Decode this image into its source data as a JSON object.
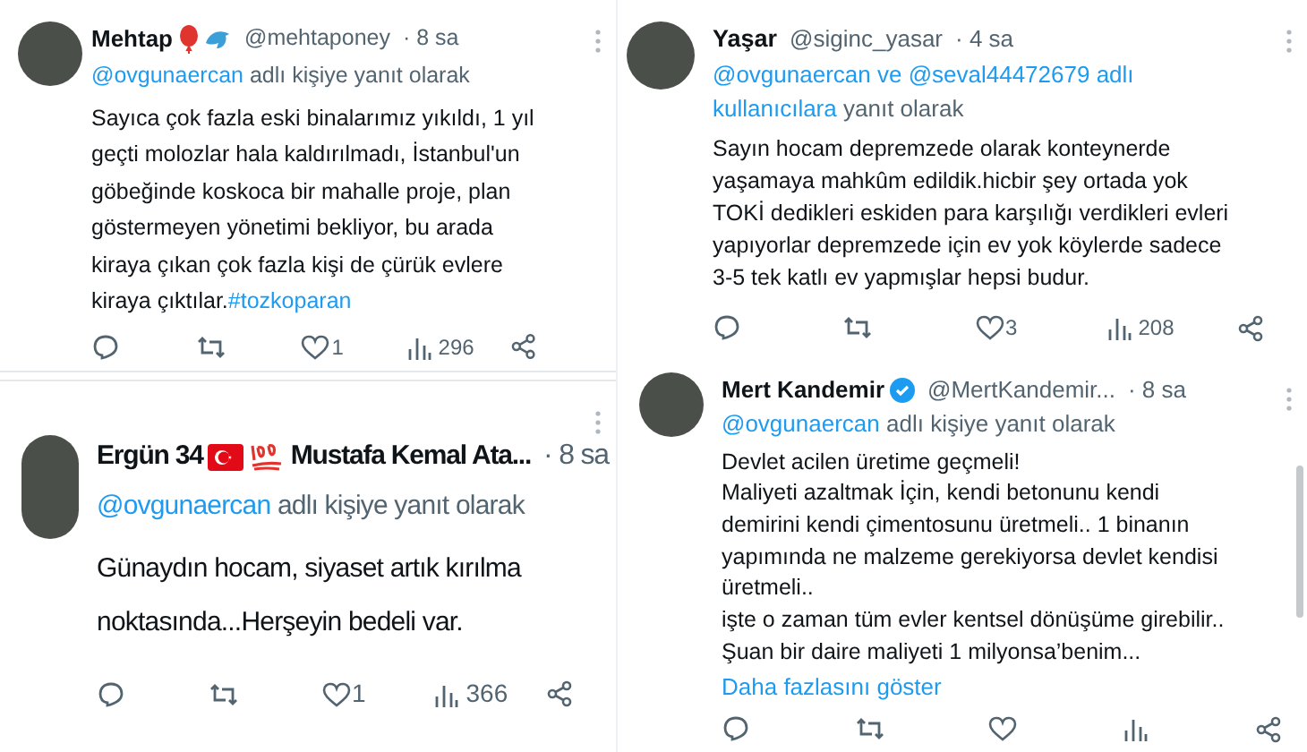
{
  "tweets": [
    {
      "name_parts": [
        {
          "kind": "text",
          "text": "Mehtap"
        },
        {
          "kind": "balloon"
        },
        {
          "kind": "dolphin"
        }
      ],
      "handle": "@mehtaponey",
      "time": "· 8 sa",
      "reply": [
        {
          "text": "@ovgunaercan",
          "link": true
        },
        {
          "text": "adlı kişiye yanıt olarak",
          "link": false
        }
      ],
      "body": "Sayıca çok fazla eski binalarımız yıkıldı, 1 yıl geçti molozlar hala kaldırılmadı, İstanbul'un göbeğinde koskoca bir mahalle proje, plan göstermeyen yönetimi bekliyor, bu arada kiraya çıkan çok fazla kişi de çürük evlere kiraya çıktılar.",
      "hashtag": "#tozkoparan",
      "stats": {
        "likes": "1",
        "views": "296"
      }
    },
    {
      "name_parts": [
        {
          "kind": "text",
          "text": "Ergün 34"
        },
        {
          "kind": "flag"
        },
        {
          "kind": "hundred"
        },
        {
          "kind": "text",
          "text": "Mustafa Kemal Ata..."
        }
      ],
      "time": "· 8 sa",
      "reply": [
        {
          "text": "@ovgunaercan",
          "link": true
        },
        {
          "text": "adlı kişiye yanıt olarak",
          "link": false
        }
      ],
      "body": "Günaydın hocam, siyaset artık kırılma noktasında...Herşeyin bedeli  var.",
      "stats": {
        "likes": "1",
        "views": "366"
      }
    },
    {
      "name_parts": [
        {
          "kind": "text",
          "text": "Yaşar"
        }
      ],
      "handle": "@siginc_yasar",
      "time": "· 4 sa",
      "reply": [
        {
          "text": "@ovgunaercan ve @seval44472679 adlı",
          "link": true
        },
        {
          "text": "kullanıcılara",
          "link": true
        },
        {
          "text": "yanıt olarak",
          "link": false
        }
      ],
      "body": "Sayın hocam depremzede olarak konteynerde yaşamaya mahkûm edildik.hicbir şey ortada yok TOKİ dedikleri eskiden para karşılığı verdikleri evleri yapıyorlar depremzede için ev yok köylerde sadece 3-5 tek katlı ev yapmışlar hepsi budur.",
      "stats": {
        "likes": "3",
        "views": "208"
      }
    },
    {
      "name_parts": [
        {
          "kind": "text",
          "text": "Mert Kandemir"
        },
        {
          "kind": "verified"
        }
      ],
      "handle": "@MertKandemir...",
      "time": "· 8 sa",
      "reply": [
        {
          "text": "@ovgunaercan",
          "link": true
        },
        {
          "text": "adlı kişiye yanıt olarak",
          "link": false
        }
      ],
      "body": "Devlet acilen üretime geçmeli!\nMaliyeti azaltmak İçin, kendi betonunu kendi demirini kendi çimentosunu üretmeli.. 1 binanın yapımında ne malzeme gerekiyorsa devlet kendisi üretmeli..\nişte o zaman tüm evler kentsel dönüşüme girebilir..\nŞuan bir daire maliyeti 1 milyonsa’benim...",
      "more_link": "Daha fazlasını göster"
    }
  ]
}
